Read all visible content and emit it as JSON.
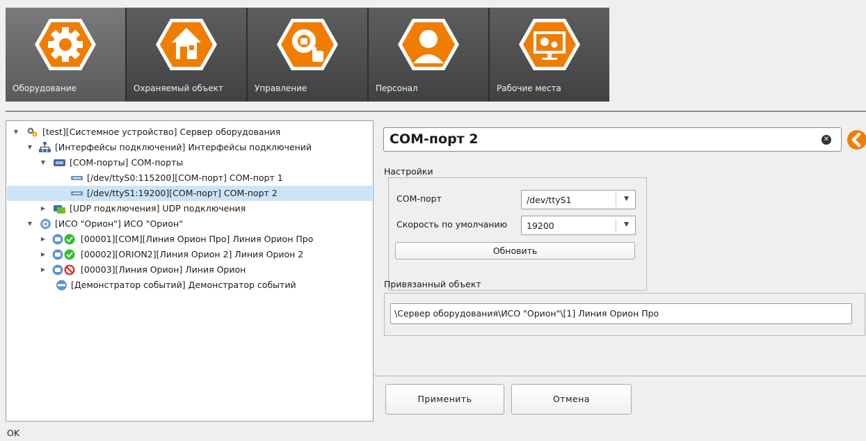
{
  "nav": {
    "tiles": [
      {
        "label": "Оборудование",
        "icon": "gear-icon",
        "active": true
      },
      {
        "label": "Охраняемый объект",
        "icon": "house-icon",
        "active": false
      },
      {
        "label": "Управление",
        "icon": "gear-lock-hand-icon",
        "active": false
      },
      {
        "label": "Персонал",
        "icon": "person-icon",
        "active": false
      },
      {
        "label": "Рабочие места",
        "icon": "monitor-gears-icon",
        "active": false
      }
    ]
  },
  "tree": {
    "items": [
      {
        "label": "[test][Системное устройство] Сервер оборудования",
        "expanded": true,
        "icon": "gears-icon"
      },
      {
        "label": "[Интерфейсы подключений] Интерфейсы подключений",
        "expanded": true,
        "icon": "network-icon"
      },
      {
        "label": "[COM-порты] COM-порты",
        "expanded": true,
        "icon": "port-group-icon"
      },
      {
        "label": "[/dev/ttyS0:115200][COM-порт] COM-порт 1",
        "icon": "com-port-icon"
      },
      {
        "label": "[/dev/ttyS1:19200][COM-порт] COM-порт 2",
        "icon": "com-port-icon",
        "selected": true
      },
      {
        "label": "[UDP подключения] UDP подключения",
        "expanded": false,
        "icon": "udp-icon"
      },
      {
        "label": "[ИСО \"Орион\"] ИСО \"Орион\"",
        "expanded": true,
        "icon": "orion-icon"
      },
      {
        "label": "[00001][COM][Линия Орион Про] Линия Орион Про",
        "expanded": false,
        "icon": "line-ok-icon"
      },
      {
        "label": "[00002][ORION2][Линия Орион 2] Линия Орион 2",
        "expanded": false,
        "icon": "line-ok-icon"
      },
      {
        "label": "[00003][Линия Орион] Линия Орион",
        "expanded": false,
        "icon": "line-disabled-icon"
      },
      {
        "label": "[Демонстратор событий] Демонстратор событий",
        "icon": "demo-icon"
      }
    ]
  },
  "detail": {
    "title": "COM-порт 2",
    "settings_label": "Настройки",
    "com_port_label": "COM-порт",
    "com_port_value": "/dev/ttyS1",
    "speed_label": "Скорость по умолчанию",
    "speed_value": "19200",
    "refresh_label": "Обновить",
    "linked_label": "Привязанный объект",
    "linked_value": "\\Сервер оборудования\\ИСО \"Орион\"\\[1] Линия Орион Про",
    "apply_label": "Применить",
    "cancel_label": "Отмена"
  },
  "status": "OK",
  "colors": {
    "accent": "#f07d00",
    "selection": "#cde4f7",
    "tile": "#4f4f4f",
    "ok_green": "#2ec12e",
    "stop_red": "#e0241d"
  }
}
